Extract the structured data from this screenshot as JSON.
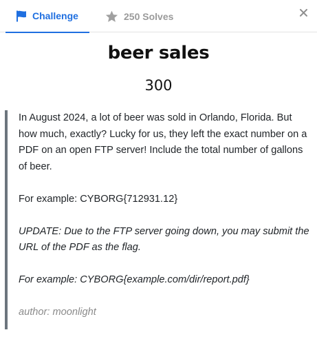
{
  "tabs": {
    "challenge_label": "Challenge",
    "solves_label": "250 Solves",
    "close_label": "×"
  },
  "challenge": {
    "name": "beer sales",
    "value": "300",
    "description": [
      "In August 2024, a lot of beer was sold in Orlando, Florida. But how much, exactly? Lucky for us, they left the exact number on a PDF on an open FTP server! Include the total number of gallons of beer.",
      "For example: CYBORG{712931.12}",
      "UPDATE: Due to the FTP server going down, you may submit the URL of the PDF as the flag.",
      "For example: CYBORG{example.com/dir/report.pdf}"
    ],
    "author": "author: moonlight"
  },
  "colors": {
    "accent": "#1f6fe0",
    "muted": "#9a9a9a",
    "quote_bar": "#6c757d"
  },
  "icons": {
    "challenge_tab": "flag-icon",
    "solves_tab": "star-icon",
    "close": "close-icon"
  }
}
